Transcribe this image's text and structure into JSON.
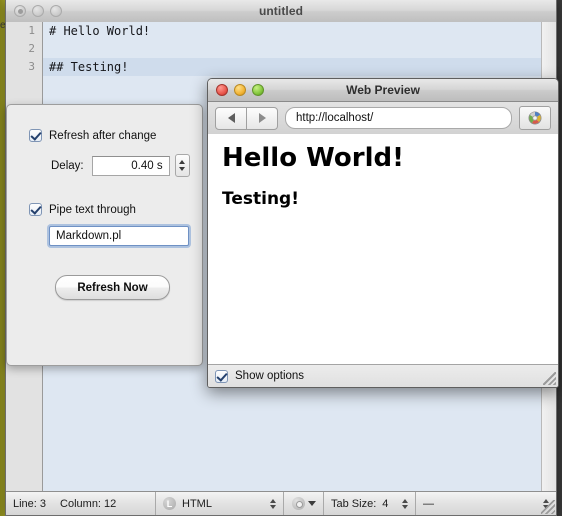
{
  "background": {
    "left_window_hint": "e"
  },
  "main_window": {
    "title": "untitled",
    "traffic_lights": [
      "close-button",
      "minimize-button",
      "zoom-button"
    ],
    "editor": {
      "lines": [
        {
          "number": "1",
          "text": "# Hello World!",
          "current": false
        },
        {
          "number": "2",
          "text": "",
          "current": false
        },
        {
          "number": "3",
          "text": "## Testing!",
          "current": true
        }
      ]
    },
    "statusbar": {
      "line_label": "Line: 3",
      "column_label": "Column: 12",
      "language": "HTML",
      "language_badge": "L",
      "tab_size_label": "Tab Size:",
      "tab_size_value": "4",
      "encoding_value": "—"
    }
  },
  "options_panel": {
    "refresh_after_change": {
      "label": "Refresh after change",
      "checked": true
    },
    "delay": {
      "label": "Delay:",
      "value": "0.40 s"
    },
    "pipe_text_through": {
      "label": "Pipe text through",
      "checked": true
    },
    "pipe_command": {
      "value": "Markdown.pl",
      "placeholder": "Markdown.pl"
    },
    "refresh_now_button": "Refresh Now"
  },
  "web_preview": {
    "title": "Web Preview",
    "traffic_lights": [
      "close-button",
      "minimize-button",
      "zoom-button"
    ],
    "toolbar": {
      "back_label": "◀",
      "forward_label": "▶",
      "url": "http://localhost/",
      "url_placeholder": "http://localhost/",
      "reload_icon": "page-loading-icon"
    },
    "content": {
      "heading1": "Hello World!",
      "heading2": "Testing!"
    },
    "footer": {
      "show_options_label": "Show options",
      "show_options_checked": true
    }
  },
  "colors": {
    "editor_background": "#dee7f2",
    "current_line": "#cfdcec",
    "chrome": "#ececec",
    "accent_focus": "#6f91c4",
    "background_window": "#a3a22a"
  }
}
